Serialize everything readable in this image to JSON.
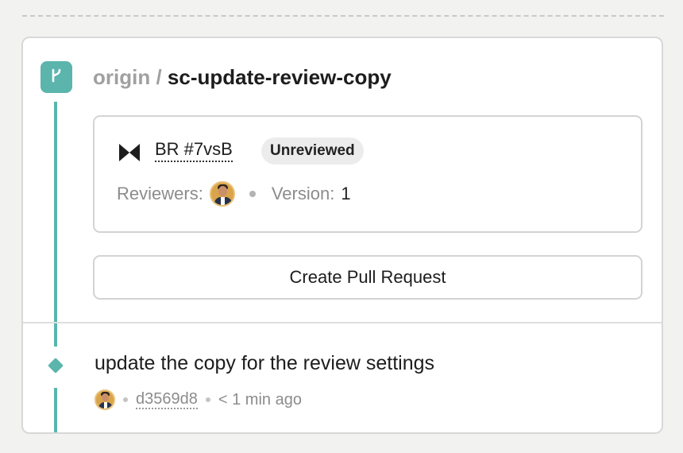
{
  "branch": {
    "remote": "origin",
    "separator": "/",
    "name": "sc-update-review-copy"
  },
  "review": {
    "id": "BR #7vsB",
    "status": "Unreviewed",
    "reviewers_label": "Reviewers:",
    "version_label": "Version:",
    "version_value": "1"
  },
  "actions": {
    "create_pr": "Create Pull Request"
  },
  "commit": {
    "message": "update the copy for the review settings",
    "sha": "d3569d8",
    "time": "< 1 min ago"
  },
  "colors": {
    "accent": "#5bb5ac",
    "background": "#f2f2f0",
    "card": "#ffffff",
    "pill": "#ececec"
  },
  "icons": {
    "branch": "branch-icon",
    "review": "bowtie-icon",
    "commit": "commit-diamond-icon"
  }
}
